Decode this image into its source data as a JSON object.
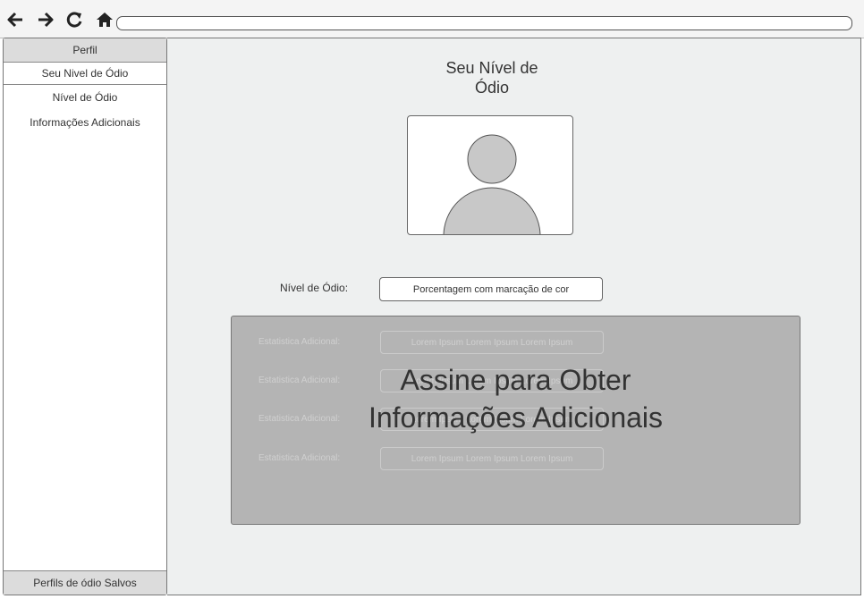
{
  "toolbar": {
    "icons": [
      "back-arrow-icon",
      "forward-arrow-icon",
      "reload-icon",
      "home-icon"
    ],
    "address_value": ""
  },
  "sidebar": {
    "header": "Perfil",
    "items": [
      {
        "label": "Seu Nivel de Ódio",
        "active": true
      },
      {
        "label": "Nível de Ódio",
        "active": false
      },
      {
        "label": "Informações Adicionais",
        "active": false
      }
    ],
    "footer": "Perfils de ódio Salvos"
  },
  "main": {
    "title": "Seu Nível de\nÓdio",
    "hate_level": {
      "label": "Nível de Ódio:",
      "value": "Porcentagem com marcação de cor"
    },
    "paywall": {
      "message": "Assine para Obter\nInformações Adicionais",
      "stats": [
        {
          "label": "Estatistica Adicional:",
          "value": "Lorem Ipsum Lorem Ipsum Lorem Ipsum"
        },
        {
          "label": "Estatistica Adicional:",
          "value": "Lorem Ipsum Lorem Ipsum Lorem Ipsum"
        },
        {
          "label": "Estatistica Adicional:",
          "value": "Lorem Ipsum Lorem Ipsum Lorem Ipsum"
        },
        {
          "label": "Estatistica Adicional:",
          "value": "Lorem Ipsum Lorem Ipsum Lorem Ipsum"
        }
      ]
    }
  },
  "colors": {
    "main_bg": "#eef0f0",
    "sidebar_header_bg": "#dcdcdc",
    "paywall_bg": "#b4b4b4",
    "text": "#333333"
  }
}
